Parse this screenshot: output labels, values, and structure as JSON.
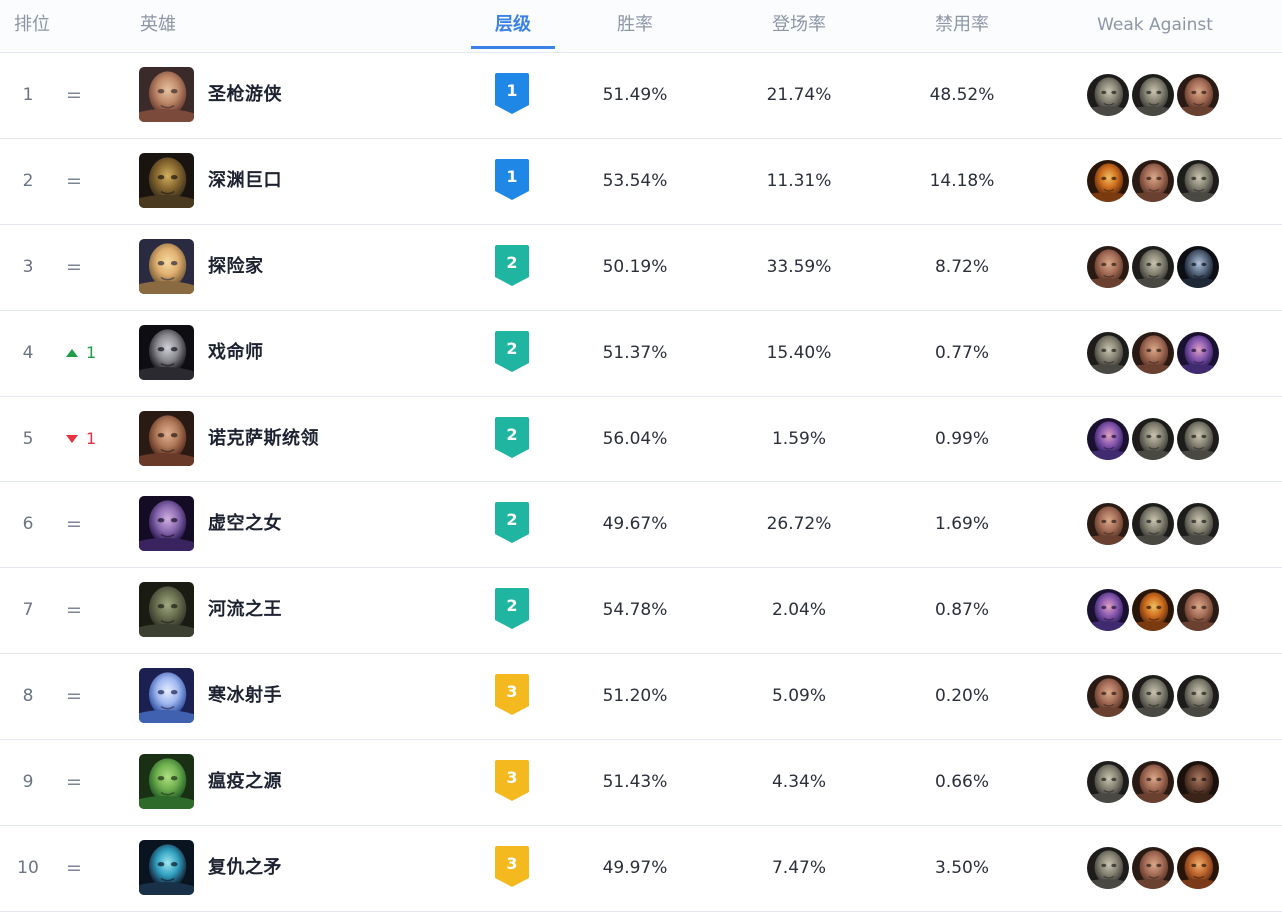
{
  "header": {
    "rank": "排位",
    "champion": "英雄",
    "tier": "层级",
    "win_rate": "胜率",
    "pick_rate": "登场率",
    "ban_rate": "禁用率",
    "weak_against": "Weak Against"
  },
  "colors": {
    "accent": "#3b82e6",
    "tier1": "#1f87e5",
    "tier2": "#1fb5a0",
    "tier3": "#f5b920",
    "up": "#1f9d46",
    "down": "#e53140"
  },
  "rows": [
    {
      "rank": "1",
      "trend": "eq",
      "symbol": "=",
      "change": "",
      "name": "圣枪游侠",
      "tier": "1",
      "win": "51.49%",
      "pick": "21.74%",
      "ban": "48.52%",
      "avatar_icon": "lucian-portrait",
      "weak": [
        "gray-beast-portrait",
        "gray-beast-portrait",
        "bald-man-portrait"
      ]
    },
    {
      "rank": "2",
      "trend": "eq",
      "symbol": "=",
      "change": "",
      "name": "深渊巨口",
      "tier": "1",
      "win": "53.54%",
      "pick": "11.31%",
      "ban": "14.18%",
      "avatar_icon": "kogmaw-portrait",
      "weak": [
        "orange-monster-portrait",
        "bald-man-portrait",
        "gray-beast-portrait"
      ]
    },
    {
      "rank": "3",
      "trend": "eq",
      "symbol": "=",
      "change": "",
      "name": "探险家",
      "tier": "2",
      "win": "50.19%",
      "pick": "33.59%",
      "ban": "8.72%",
      "avatar_icon": "ezreal-portrait",
      "weak": [
        "bald-man-portrait",
        "gray-beast-portrait",
        "dark-knight-portrait"
      ]
    },
    {
      "rank": "4",
      "trend": "up",
      "symbol": "",
      "change": "1",
      "name": "戏命师",
      "tier": "2",
      "win": "51.37%",
      "pick": "15.40%",
      "ban": "0.77%",
      "avatar_icon": "jhin-portrait",
      "weak": [
        "gray-beast-portrait",
        "bald-man-portrait",
        "purple-mage-portrait"
      ]
    },
    {
      "rank": "5",
      "trend": "down",
      "symbol": "",
      "change": "1",
      "name": "诺克萨斯统领",
      "tier": "2",
      "win": "56.04%",
      "pick": "1.59%",
      "ban": "0.99%",
      "avatar_icon": "swain-portrait",
      "weak": [
        "purple-mage-portrait",
        "gray-beast-portrait",
        "gray-beast-portrait"
      ]
    },
    {
      "rank": "6",
      "trend": "eq",
      "symbol": "=",
      "change": "",
      "name": "虚空之女",
      "tier": "2",
      "win": "49.67%",
      "pick": "26.72%",
      "ban": "1.69%",
      "avatar_icon": "kaisa-portrait",
      "weak": [
        "bald-man-portrait",
        "gray-beast-portrait",
        "gray-beast-portrait"
      ]
    },
    {
      "rank": "7",
      "trend": "eq",
      "symbol": "=",
      "change": "",
      "name": "河流之王",
      "tier": "2",
      "win": "54.78%",
      "pick": "2.04%",
      "ban": "0.87%",
      "avatar_icon": "tahm-kench-portrait",
      "weak": [
        "purple-mage-portrait",
        "orange-monster-portrait",
        "bald-man-portrait"
      ]
    },
    {
      "rank": "8",
      "trend": "eq",
      "symbol": "=",
      "change": "",
      "name": "寒冰射手",
      "tier": "3",
      "win": "51.20%",
      "pick": "5.09%",
      "ban": "0.20%",
      "avatar_icon": "ashe-portrait",
      "weak": [
        "bald-man-portrait",
        "gray-beast-portrait",
        "gray-beast-portrait"
      ]
    },
    {
      "rank": "9",
      "trend": "eq",
      "symbol": "=",
      "change": "",
      "name": "瘟疫之源",
      "tier": "3",
      "win": "51.43%",
      "pick": "4.34%",
      "ban": "0.66%",
      "avatar_icon": "twitch-portrait",
      "weak": [
        "gray-beast-portrait",
        "bald-man-portrait",
        "dark-man-portrait"
      ]
    },
    {
      "rank": "10",
      "trend": "eq",
      "symbol": "=",
      "change": "",
      "name": "复仇之矛",
      "tier": "3",
      "win": "49.97%",
      "pick": "7.47%",
      "ban": "3.50%",
      "avatar_icon": "kalista-portrait",
      "weak": [
        "gray-beast-portrait",
        "bald-man-portrait",
        "orange-man-portrait"
      ]
    }
  ]
}
